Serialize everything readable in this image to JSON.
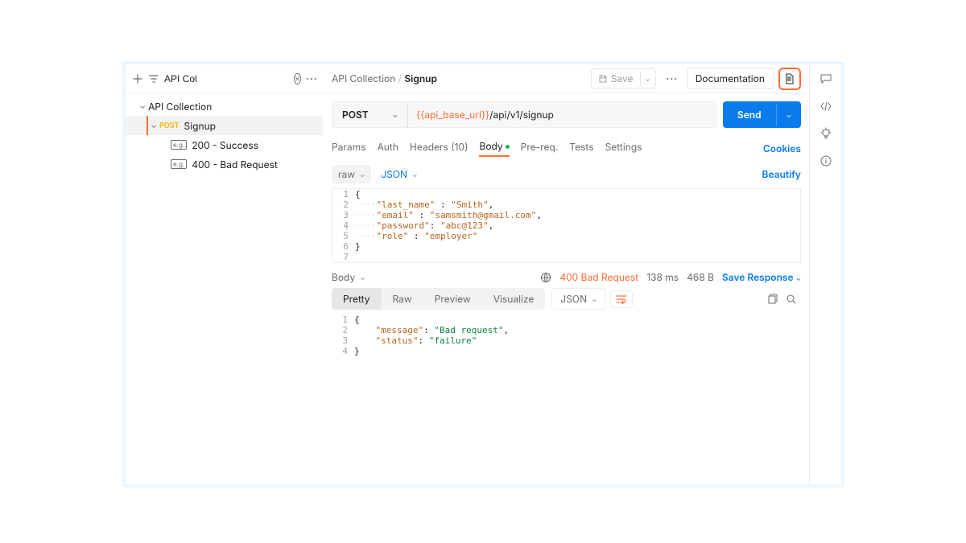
{
  "sidebar": {
    "search_value": "API Col",
    "collection_label": "API Collection",
    "request_method": "POST",
    "request_name": "Signup",
    "examples": [
      {
        "label": "200 - Success"
      },
      {
        "label": "400 - Bad Request"
      }
    ]
  },
  "header": {
    "crumb_collection": "API Collection",
    "crumb_current": "Signup",
    "save_label": "Save",
    "documentation_label": "Documentation"
  },
  "url_row": {
    "method": "POST",
    "variable": "{{api_base_url}}",
    "path": "/api/v1/signup",
    "send_label": "Send"
  },
  "req_tabs": {
    "params": "Params",
    "auth": "Auth",
    "headers": "Headers (10)",
    "body": "Body",
    "prereq": "Pre-req.",
    "tests": "Tests",
    "settings": "Settings",
    "cookies": "Cookies"
  },
  "body_row": {
    "raw": "raw",
    "json": "JSON",
    "beautify": "Beautify"
  },
  "req_code": {
    "l1": "{",
    "l2_k": "\"last_name\"",
    "l2_v": "\"Smith\"",
    "l3_k": "\"email\"",
    "l3_v": "\"samsmith@gmail.com\"",
    "l4_k": "\"password\"",
    "l4_v": "\"abc@123\"",
    "l5_k": "\"role\"",
    "l5_v": "\"employer\"",
    "l6": "}"
  },
  "resp_head": {
    "body": "Body",
    "status": "400 Bad Request",
    "time": "138 ms",
    "size": "468 B",
    "save_response": "Save Response"
  },
  "resp_tabs": {
    "pretty": "Pretty",
    "raw": "Raw",
    "preview": "Preview",
    "visualize": "Visualize",
    "json": "JSON"
  },
  "resp_code": {
    "l1": "{",
    "l2_k": "\"message\"",
    "l2_v": "\"Bad request\"",
    "l3_k": "\"status\"",
    "l3_v": "\"failure\"",
    "l4": "}"
  }
}
